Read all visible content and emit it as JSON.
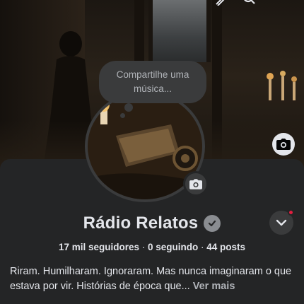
{
  "header": {
    "icons": [
      "edit-icon",
      "search-icon"
    ]
  },
  "cover": {
    "camera_icon": "camera-icon"
  },
  "avatar": {
    "camera_icon": "camera-icon"
  },
  "music_prompt": {
    "text": "Compartilhe uma música..."
  },
  "profile": {
    "name": "Rádio Relatos",
    "verified_icon": "verified-badge-icon",
    "followers": "17 mil seguidores",
    "following": "0 seguindo",
    "posts": "44 posts",
    "separator": " · ",
    "bio": "Riram. Humilharam. Ignoraram. Mas nunca imaginaram o que estava por vir. Histórias de época que...",
    "see_more": "Ver mais"
  },
  "colors": {
    "background": "#242526",
    "surface": "#3a3b3c",
    "text": "#e4e6eb",
    "secondary_text": "#b0b3b8",
    "notification": "#e41e3f"
  }
}
